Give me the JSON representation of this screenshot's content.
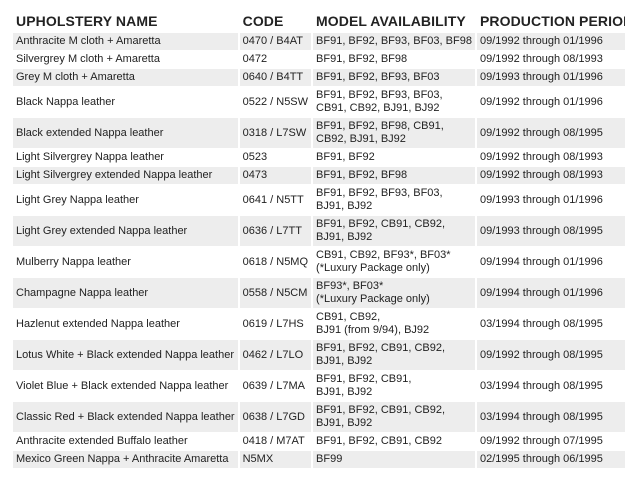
{
  "table": {
    "headers": [
      "UPHOLSTERY NAME",
      "CODE",
      "MODEL AVAILABILITY",
      "PRODUCTION PERIOD"
    ],
    "rows": [
      {
        "name": "Anthracite M cloth + Amaretta",
        "code": "0470 / B4AT",
        "models": [
          "BF91, BF92, BF93, BF03, BF98"
        ],
        "period": "09/1992 through 01/1996"
      },
      {
        "name": "Silvergrey M cloth + Amaretta",
        "code": "0472",
        "models": [
          "BF91, BF92, BF98"
        ],
        "period": "09/1992 through 08/1993"
      },
      {
        "name": "Grey M cloth + Amaretta",
        "code": "0640 / B4TT",
        "models": [
          "BF91, BF92, BF93, BF03"
        ],
        "period": "09/1993 through 01/1996"
      },
      {
        "name": "Black Nappa leather",
        "code": "0522 / N5SW",
        "models": [
          "BF91, BF92, BF93, BF03,",
          "CB91, CB92, BJ91, BJ92"
        ],
        "period": "09/1992 through 01/1996"
      },
      {
        "name": "Black extended Nappa leather",
        "code": "0318 / L7SW",
        "models": [
          "BF91, BF92, BF98, CB91,",
          "CB92, BJ91, BJ92"
        ],
        "period": "09/1992 through 08/1995"
      },
      {
        "name": "Light Silvergrey Nappa leather",
        "code": "0523",
        "models": [
          "BF91, BF92"
        ],
        "period": "09/1992 through 08/1993"
      },
      {
        "name": "Light Silvergrey extended Nappa leather",
        "code": "0473",
        "models": [
          "BF91, BF92, BF98"
        ],
        "period": "09/1992 through 08/1993"
      },
      {
        "name": "Light Grey Nappa leather",
        "code": "0641 / N5TT",
        "models": [
          "BF91, BF92, BF93, BF03,",
          "BJ91, BJ92"
        ],
        "period": "09/1993 through 01/1996"
      },
      {
        "name": "Light Grey extended Nappa leather",
        "code": "0636 / L7TT",
        "models": [
          "BF91, BF92, CB91, CB92,",
          "BJ91, BJ92"
        ],
        "period": "09/1993 through 08/1995"
      },
      {
        "name": "Mulberry Nappa leather",
        "code": "0618 / N5MQ",
        "models": [
          "CB91, CB92, BF93*, BF03*",
          "(*Luxury Package only)"
        ],
        "period": "09/1994 through 01/1996"
      },
      {
        "name": "Champagne Nappa leather",
        "code": "0558 / N5CM",
        "models": [
          "BF93*, BF03*",
          "(*Luxury Package only)"
        ],
        "period": "09/1994 through 01/1996"
      },
      {
        "name": "Hazlenut extended Nappa leather",
        "code": "0619 / L7HS",
        "models": [
          "CB91, CB92,",
          "BJ91 (from 9/94), BJ92"
        ],
        "period": "03/1994 through 08/1995"
      },
      {
        "name": "Lotus White + Black extended Nappa leather",
        "code": "0462 / L7LO",
        "models": [
          "BF91, BF92, CB91, CB92,",
          "BJ91, BJ92"
        ],
        "period": "09/1992 through 08/1995"
      },
      {
        "name": "Violet Blue + Black extended Nappa leather",
        "code": "0639 / L7MA",
        "models": [
          "BF91, BF92, CB91,",
          "BJ91, BJ92"
        ],
        "period": "03/1994 through 08/1995"
      },
      {
        "name": "Classic Red + Black extended Nappa leather",
        "code": "0638 / L7GD",
        "models": [
          "BF91, BF92, CB91, CB92,",
          "BJ91, BJ92"
        ],
        "period": "03/1994 through 08/1995"
      },
      {
        "name": "Anthracite extended Buffalo leather",
        "code": "0418 / M7AT",
        "models": [
          "BF91, BF92, CB91, CB92"
        ],
        "period": "09/1992 through 07/1995"
      },
      {
        "name": "Mexico Green Nappa + Anthracite Amaretta",
        "code": "N5MX",
        "models": [
          "BF99"
        ],
        "period": "02/1995 through 06/1995"
      }
    ]
  }
}
